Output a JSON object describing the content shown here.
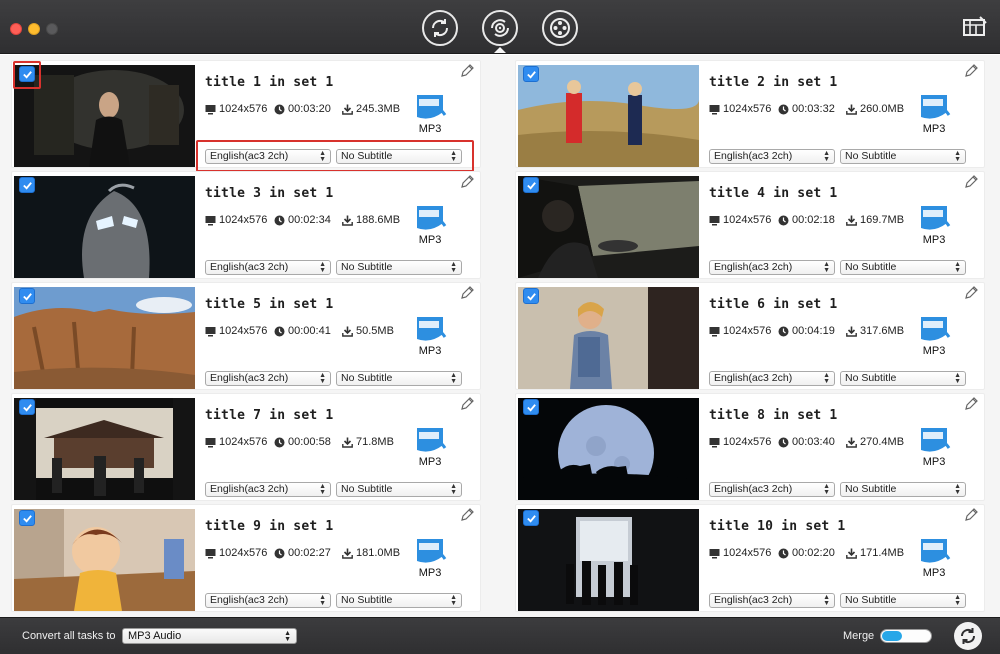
{
  "header": {
    "modes": [
      {
        "icon": "convert-icon"
      },
      {
        "icon": "rip-disc-icon",
        "active": true
      },
      {
        "icon": "film-reel-icon"
      }
    ],
    "toolbox_icon": "toolbox-icon"
  },
  "items": [
    {
      "title": "title 1 in set 1",
      "resolution": "1024x576",
      "duration": "00:03:20",
      "size": "245.3MB",
      "format": "MP3",
      "audio": "English(ac3 2ch)",
      "subtitle": "No Subtitle",
      "checked": true
    },
    {
      "title": "title 2 in set 1",
      "resolution": "1024x576",
      "duration": "00:03:32",
      "size": "260.0MB",
      "format": "MP3",
      "audio": "English(ac3 2ch)",
      "subtitle": "No Subtitle",
      "checked": true
    },
    {
      "title": "title 3 in set 1",
      "resolution": "1024x576",
      "duration": "00:02:34",
      "size": "188.6MB",
      "format": "MP3",
      "audio": "English(ac3 2ch)",
      "subtitle": "No Subtitle",
      "checked": true
    },
    {
      "title": "title 4 in set 1",
      "resolution": "1024x576",
      "duration": "00:02:18",
      "size": "169.7MB",
      "format": "MP3",
      "audio": "English(ac3 2ch)",
      "subtitle": "No Subtitle",
      "checked": true
    },
    {
      "title": "title 5 in set 1",
      "resolution": "1024x576",
      "duration": "00:00:41",
      "size": "50.5MB",
      "format": "MP3",
      "audio": "English(ac3 2ch)",
      "subtitle": "No Subtitle",
      "checked": true
    },
    {
      "title": "title 6 in set 1",
      "resolution": "1024x576",
      "duration": "00:04:19",
      "size": "317.6MB",
      "format": "MP3",
      "audio": "English(ac3 2ch)",
      "subtitle": "No Subtitle",
      "checked": true
    },
    {
      "title": "title 7 in set 1",
      "resolution": "1024x576",
      "duration": "00:00:58",
      "size": "71.8MB",
      "format": "MP3",
      "audio": "English(ac3 2ch)",
      "subtitle": "No Subtitle",
      "checked": true
    },
    {
      "title": "title 8 in set 1",
      "resolution": "1024x576",
      "duration": "00:03:40",
      "size": "270.4MB",
      "format": "MP3",
      "audio": "English(ac3 2ch)",
      "subtitle": "No Subtitle",
      "checked": true
    },
    {
      "title": "title 9 in set 1",
      "resolution": "1024x576",
      "duration": "00:02:27",
      "size": "181.0MB",
      "format": "MP3",
      "audio": "English(ac3 2ch)",
      "subtitle": "No Subtitle",
      "checked": true
    },
    {
      "title": "title 10 in set 1",
      "resolution": "1024x576",
      "duration": "00:02:20",
      "size": "171.4MB",
      "format": "MP3",
      "audio": "English(ac3 2ch)",
      "subtitle": "No Subtitle",
      "checked": true
    }
  ],
  "footer": {
    "convert_label": "Convert all tasks to",
    "convert_value": "MP3 Audio",
    "merge_label": "Merge",
    "merge_on": false,
    "convert_icon": "convert-start-icon"
  },
  "colors": {
    "accent": "#2f8cf0",
    "highlight": "#d8322d",
    "toggle": "#27a7e8",
    "titlebar": "#353537"
  }
}
